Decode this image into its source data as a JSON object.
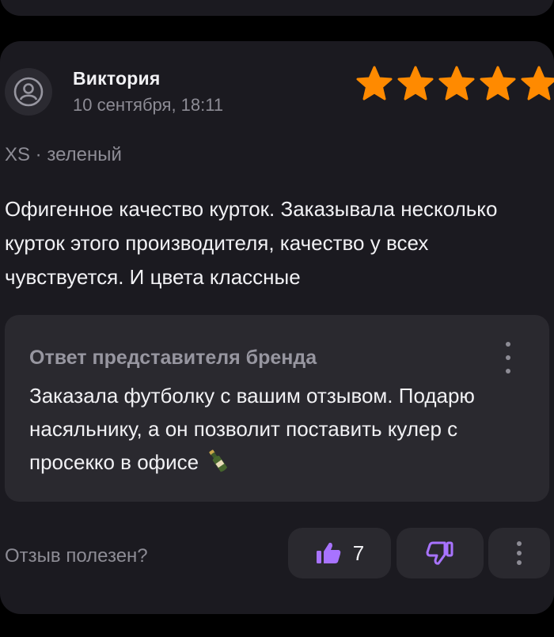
{
  "review": {
    "author": "Виктория",
    "date": "10 сентября, 18:11",
    "rating": 5,
    "rating_max": 5,
    "star_color": "#ff8a00",
    "variant": "XS · зеленый",
    "text": "Офигенное качество курток. Заказывала несколько курток этого производителя, качество у всех чувствуется. И цвета классные"
  },
  "brand_reply": {
    "title": "Ответ представителя бренда",
    "text": "Заказала футболку с вашим отзывом. Подарю насяльнику, а он позволит поставить кулер с просекко в офисе",
    "emoji": "bottle-icon"
  },
  "actions": {
    "helpful_label": "Отзыв полезен?",
    "like_count": "7",
    "accent_color": "#a873ff"
  }
}
